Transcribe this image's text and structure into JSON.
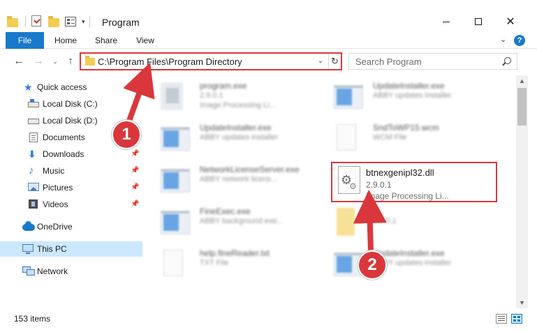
{
  "window": {
    "title": "Program",
    "controls": {
      "minimize": "",
      "maximize": "",
      "close": "✕"
    }
  },
  "ribbon": {
    "tabs": [
      "File",
      "Home",
      "Share",
      "View"
    ],
    "collapse_glyph": "⌄",
    "help_glyph": "?"
  },
  "nav": {
    "back": "←",
    "forward": "→",
    "recent": "⌄",
    "up": "↑",
    "address": "C:\\Program Files\\Program Directory",
    "address_dropdown": "⌄",
    "refresh": "↻",
    "search_placeholder": "Search Program"
  },
  "sidebar": {
    "items": [
      {
        "label": "Quick access",
        "icon": "star-icon"
      },
      {
        "label": "Local Disk (C:)",
        "icon": "local-disk-icon",
        "pinned": true
      },
      {
        "label": "Local Disk (D:)",
        "icon": "local-disk-icon"
      },
      {
        "label": "Documents",
        "icon": "documents-icon"
      },
      {
        "label": "Downloads",
        "icon": "downloads-icon",
        "pinned": true
      },
      {
        "label": "Music",
        "icon": "music-icon",
        "pinned": true
      },
      {
        "label": "Pictures",
        "icon": "pictures-icon",
        "pinned": true
      },
      {
        "label": "Videos",
        "icon": "videos-icon",
        "pinned": true
      },
      {
        "label": "OneDrive",
        "icon": "onedrive-icon"
      },
      {
        "label": "This PC",
        "icon": "this-pc-icon",
        "selected": true
      },
      {
        "label": "Network",
        "icon": "network-icon"
      }
    ],
    "pin_glyph": "📌"
  },
  "files": [
    {
      "name": "program.exe",
      "line2": "2.9.0.1",
      "line3": "Image Processing Li...",
      "icon": "program-exe-icon"
    },
    {
      "name": "UpdateInstaller.exe",
      "line2": "ABBY updates installer",
      "line3": "",
      "icon": "window-app-icon"
    },
    {
      "name": "UpdateInstaller.exe",
      "line2": "ABBY updates installer",
      "line3": "",
      "icon": "window-app-icon"
    },
    {
      "name": "SndToWP15.wcm",
      "line2": "WCM File",
      "line3": "",
      "icon": "blank-file-icon"
    },
    {
      "name": "NetworkLicenseServer.exe",
      "line2": "ABBY network licens...",
      "line3": "",
      "icon": "window-app-icon"
    },
    {
      "name": "btnexgenipl32.dll",
      "line2": "2.9.0.1",
      "line3": "Image Processing Li...",
      "icon": "dll-gear-icon"
    },
    {
      "name": "FineExec.exe",
      "line2": "ABBY background exe...",
      "line3": "",
      "icon": "window-app-icon"
    },
    {
      "name": "",
      "line2": "2.9.0.1",
      "line3": "",
      "icon": "folder-file-icon"
    },
    {
      "name": "help.fineReader.txt",
      "line2": "TXT File",
      "line3": "",
      "icon": "text-file-icon"
    },
    {
      "name": "UpdateInstaller.exe",
      "line2": "ABBY updates installer",
      "line3": "",
      "icon": "window-app-icon"
    }
  ],
  "status": {
    "items_count": "153 items"
  },
  "annotations": {
    "step1": "1",
    "step2": "2",
    "color": "#d9373c"
  },
  "colors": {
    "accent": "#1979ca",
    "selection": "#cce8ff",
    "highlight": "#d9373c"
  }
}
